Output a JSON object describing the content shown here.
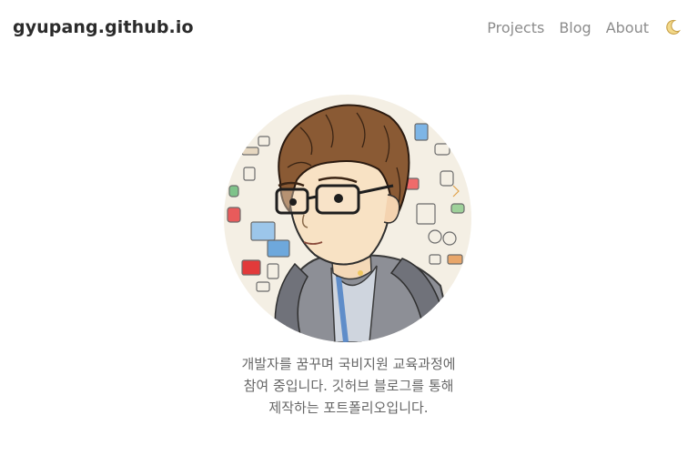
{
  "header": {
    "site_title": "gyupang.github.io",
    "nav": [
      {
        "label": "Projects"
      },
      {
        "label": "Blog"
      },
      {
        "label": "About"
      }
    ],
    "theme_toggle_icon": "moon-icon"
  },
  "profile": {
    "avatar_icon": "profile-illustration",
    "bio_lines": [
      "개발자를 꿈꾸며 국비지원 교육과정에",
      "참여 중입니다. 깃허브 블로그를 통해",
      "제작하는 포트폴리오입니다."
    ]
  },
  "colors": {
    "title": "#2b2b2b",
    "nav": "#8c8c8c",
    "bio": "#666666",
    "moon": "#e8c46a"
  }
}
